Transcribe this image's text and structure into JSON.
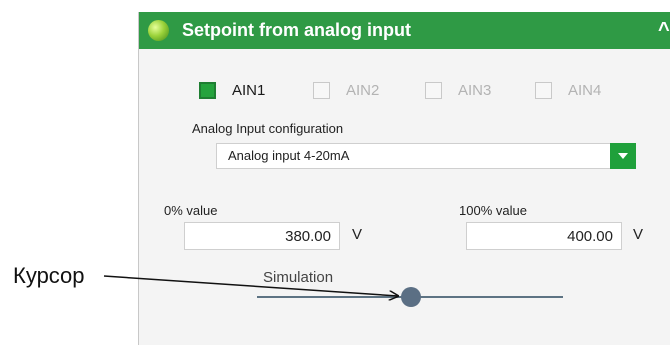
{
  "header": {
    "title": "Setpoint from analog input",
    "accent": "#2f9a45",
    "collapse_icon": "chevron-up-icon"
  },
  "inputs": [
    {
      "label": "AIN1",
      "checked": true,
      "enabled": true
    },
    {
      "label": "AIN2",
      "checked": false,
      "enabled": false
    },
    {
      "label": "AIN3",
      "checked": false,
      "enabled": false
    },
    {
      "label": "AIN4",
      "checked": false,
      "enabled": false
    }
  ],
  "config": {
    "label": "Analog Input configuration",
    "selected": "Analog input 4-20mA"
  },
  "zero": {
    "label": "0% value",
    "value": "380.00",
    "unit": "V"
  },
  "hundred": {
    "label": "100% value",
    "value": "400.00",
    "unit": "V"
  },
  "simulation": {
    "label": "Simulation",
    "position_fraction": 0.5
  },
  "annotation": {
    "label": "Курсор"
  }
}
